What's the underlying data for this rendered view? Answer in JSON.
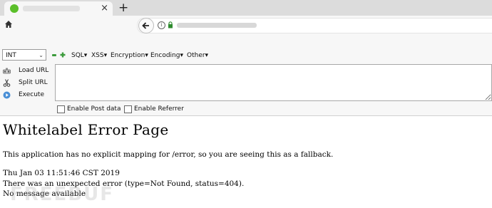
{
  "browser": {
    "tab": {
      "close_label": "×"
    },
    "new_tab_label": "+"
  },
  "hackbar": {
    "select": {
      "selected": "INT"
    },
    "menu": [
      "SQL▾",
      "XSS▾",
      "Encryption▾",
      "Encoding▾",
      "Other▾"
    ],
    "actions": [
      "Load URL",
      "Split URL",
      "Execute"
    ],
    "textarea_value": "",
    "checkboxes": [
      "Enable Post data",
      "Enable Referrer"
    ]
  },
  "page": {
    "title": "Whitelabel Error Page",
    "lines": [
      "This application has no explicit mapping for /error, so you are seeing this as a fallback.",
      "Thu Jan 03 11:51:46 CST 2019",
      "There was an unexpected error (type=Not Found, status=404).",
      "No message available"
    ]
  },
  "watermark": "FREEBUF",
  "colors": {
    "tabstrip": "#dcdcdc",
    "toolbar": "#f7f7f7",
    "accent_green": "#5bbf2a"
  }
}
